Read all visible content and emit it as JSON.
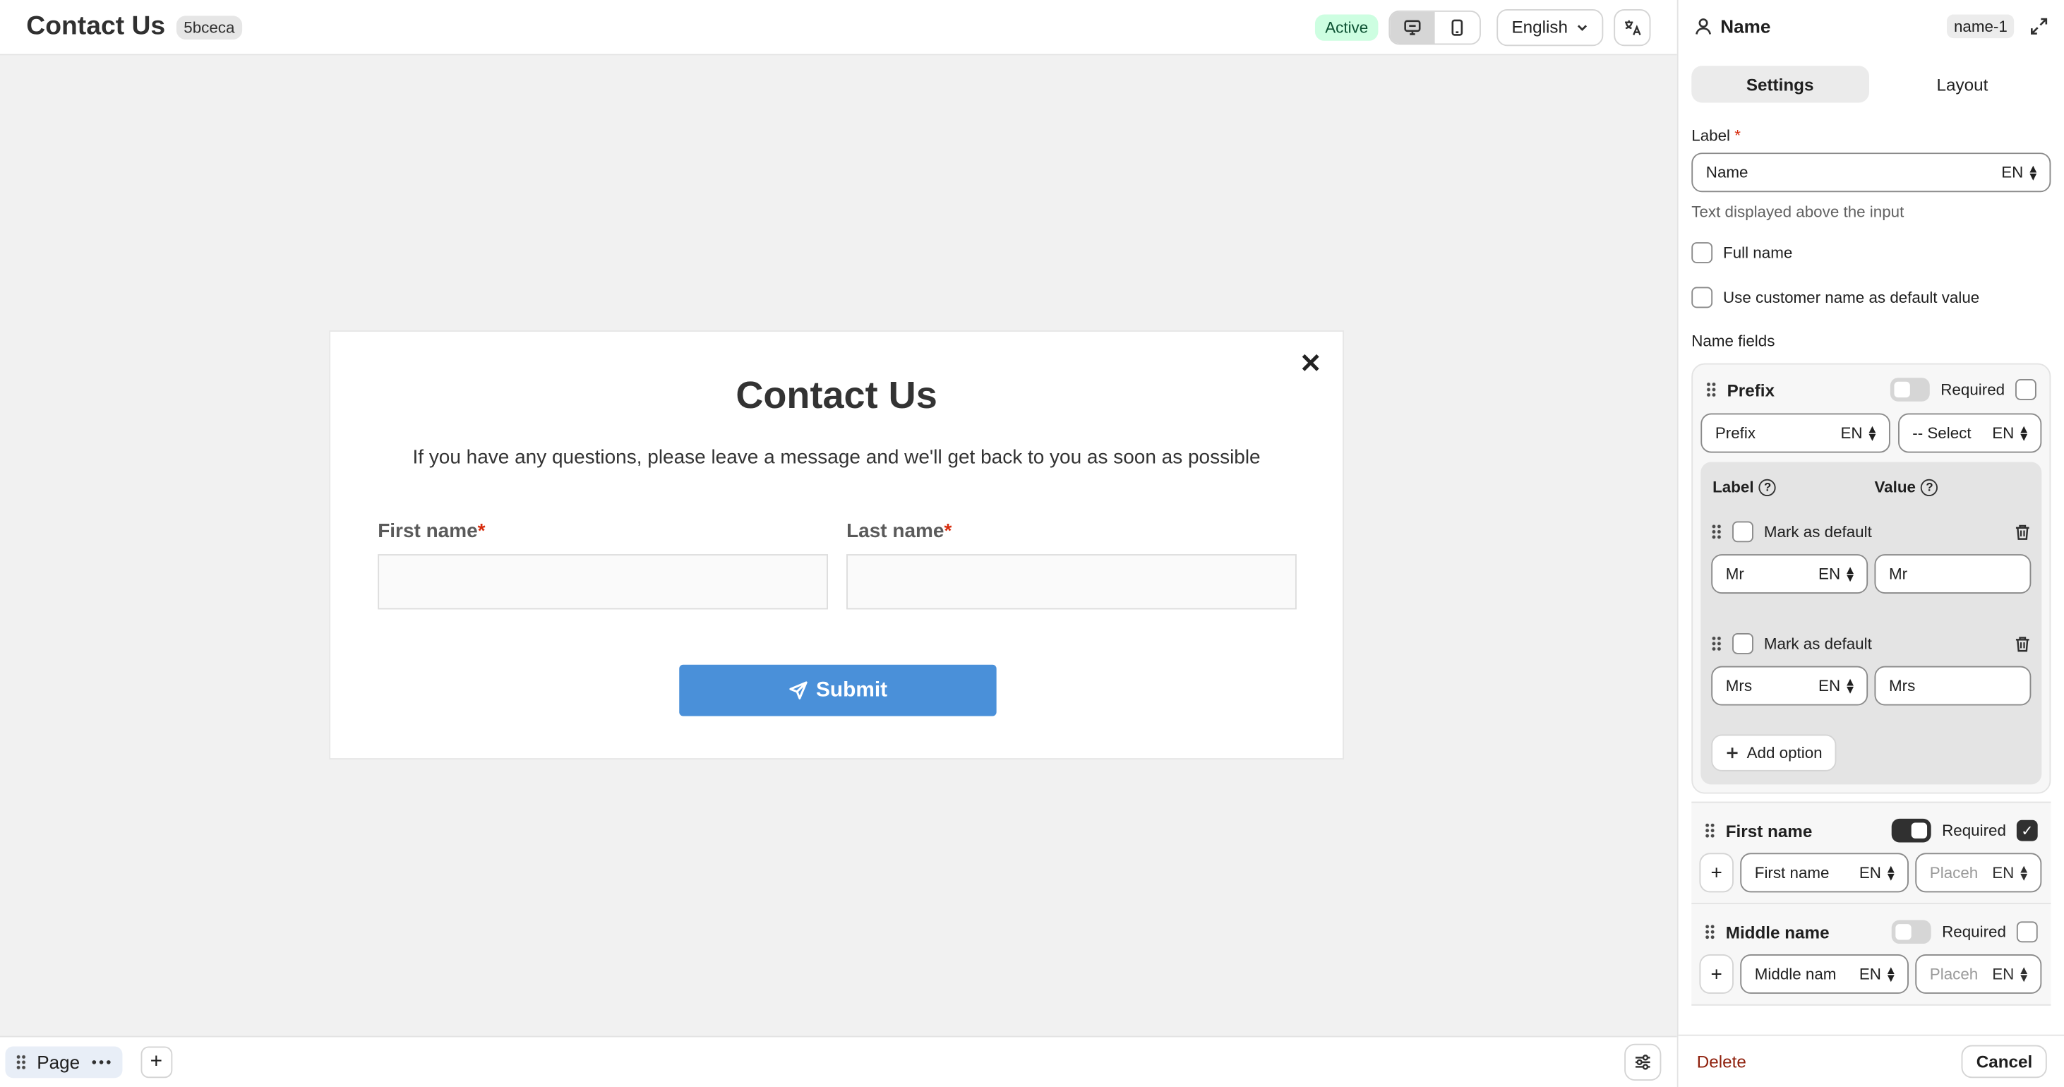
{
  "header": {
    "title": "Contact Us",
    "id_badge": "5bceca",
    "status": "Active",
    "language": "English"
  },
  "form": {
    "title": "Contact Us",
    "description": "If you have any questions, please leave a message and we'll get back to you as soon as possible",
    "first_name_label": "First name",
    "last_name_label": "Last name",
    "required_marker": "*",
    "submit_label": "Submit",
    "close_glyph": "✕"
  },
  "bottom": {
    "page_label": "Page",
    "add_glyph": "+"
  },
  "panel": {
    "title": "Name",
    "element_id": "name-1",
    "tabs": [
      "Settings",
      "Layout"
    ],
    "label_title": "Label",
    "label_required": "*",
    "label_value": "Name",
    "lang_code": "EN",
    "label_help": "Text displayed above the input",
    "full_name": "Full name",
    "use_customer_name": "Use customer name as default value",
    "name_fields_title": "Name fields",
    "required_text": "Required",
    "prefix": {
      "title": "Prefix",
      "label_value": "Prefix",
      "placeholder_value": "-- Select",
      "col_label": "Label",
      "col_value": "Value",
      "mark_default": "Mark as default",
      "options": [
        {
          "label": "Mr",
          "value": "Mr"
        },
        {
          "label": "Mrs",
          "value": "Mrs"
        }
      ],
      "add_option": "Add option"
    },
    "first_name": {
      "title": "First name",
      "label_value": "First name",
      "placeholder_value": "Placeh"
    },
    "middle_name": {
      "title": "Middle name",
      "label_value": "Middle nam",
      "placeholder_value": "Placeh"
    },
    "delete_label": "Delete",
    "cancel_label": "Cancel"
  },
  "colors": {
    "submit": "#4a90d9",
    "active_badge_bg": "#cdfee1",
    "required": "#d72c0d"
  }
}
